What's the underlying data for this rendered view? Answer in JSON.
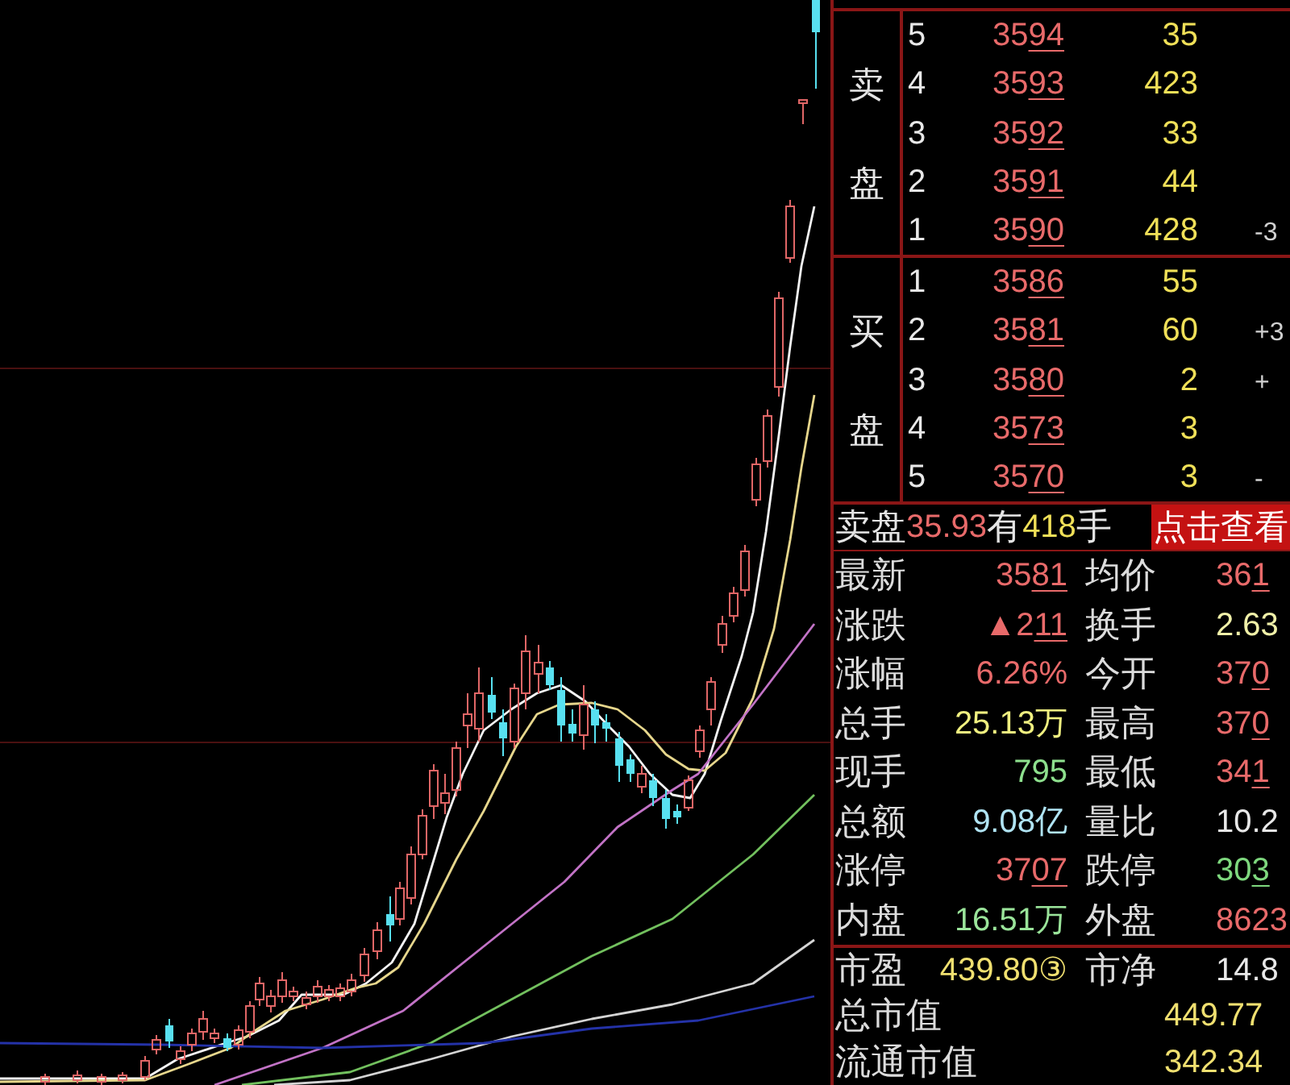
{
  "order_book": {
    "sell": {
      "label": "卖盘",
      "rows": [
        {
          "level": "5",
          "price": "3594",
          "volume": "35"
        },
        {
          "level": "4",
          "price": "3593",
          "volume": "423"
        },
        {
          "level": "3",
          "price": "3592",
          "volume": "33"
        },
        {
          "level": "2",
          "price": "3591",
          "volume": "44"
        },
        {
          "level": "1",
          "price": "3590",
          "volume": "428",
          "change": "-3"
        }
      ]
    },
    "buy": {
      "label": "买盘",
      "rows": [
        {
          "level": "1",
          "price": "3586",
          "volume": "55"
        },
        {
          "level": "2",
          "price": "3581",
          "volume": "60",
          "change": "+3"
        },
        {
          "level": "3",
          "price": "3580",
          "volume": "2",
          "change": "+"
        },
        {
          "level": "4",
          "price": "3573",
          "volume": "3"
        },
        {
          "level": "5",
          "price": "3570",
          "volume": "3",
          "change": "-"
        }
      ]
    }
  },
  "sell_summary": {
    "label": "卖盘",
    "price": "35.93",
    "word": "有",
    "volume": "418",
    "unit": "手",
    "button": "点击查看"
  },
  "quote_stats": [
    {
      "label": "最新",
      "value": "3581",
      "kind": "price",
      "color": "#e86a6a"
    },
    {
      "label": "均价",
      "value": "361",
      "kind": "price",
      "color": "#e86a6a"
    },
    {
      "label": "涨跌",
      "value": "▲211",
      "kind": "price",
      "color": "#e86a6a"
    },
    {
      "label": "换手",
      "value": "2.63",
      "kind": "plain",
      "color": "#f0f0a8"
    },
    {
      "label": "涨幅",
      "value": "6.26%",
      "kind": "plain",
      "color": "#e86a6a"
    },
    {
      "label": "今开",
      "value": "370",
      "kind": "price",
      "color": "#e86a6a"
    },
    {
      "label": "总手",
      "value": "25.13万",
      "kind": "plain",
      "color": "#f0f080"
    },
    {
      "label": "最高",
      "value": "370",
      "kind": "price",
      "color": "#e86a6a"
    },
    {
      "label": "现手",
      "value": "795",
      "kind": "plain",
      "color": "#8ee08e"
    },
    {
      "label": "最低",
      "value": "341",
      "kind": "price",
      "color": "#e86a6a"
    },
    {
      "label": "总额",
      "value": "9.08亿",
      "kind": "plain",
      "color": "#b0e4f4"
    },
    {
      "label": "量比",
      "value": "10.2",
      "kind": "plain",
      "color": "#e8e8e8"
    },
    {
      "label": "涨停",
      "value": "3707",
      "kind": "price",
      "color": "#e86a6a"
    },
    {
      "label": "跌停",
      "value": "303",
      "kind": "price",
      "color": "#7ed87e"
    },
    {
      "label": "内盘",
      "value": "16.51万",
      "kind": "plain",
      "color": "#9ae49a"
    },
    {
      "label": "外盘",
      "value": "8623",
      "kind": "plain",
      "color": "#e86a6a"
    }
  ],
  "valuation_rows": [
    [
      {
        "label": "市盈",
        "value": "439.80③",
        "color": "#f0e070"
      },
      {
        "label": "市净",
        "value": "14.8",
        "color": "#e8e8e8"
      }
    ],
    [
      {
        "label": "总市值",
        "value": "449.77",
        "color": "#f0e070"
      }
    ],
    [
      {
        "label": "流通市值",
        "value": "342.34",
        "color": "#f0e070"
      }
    ]
  ]
}
